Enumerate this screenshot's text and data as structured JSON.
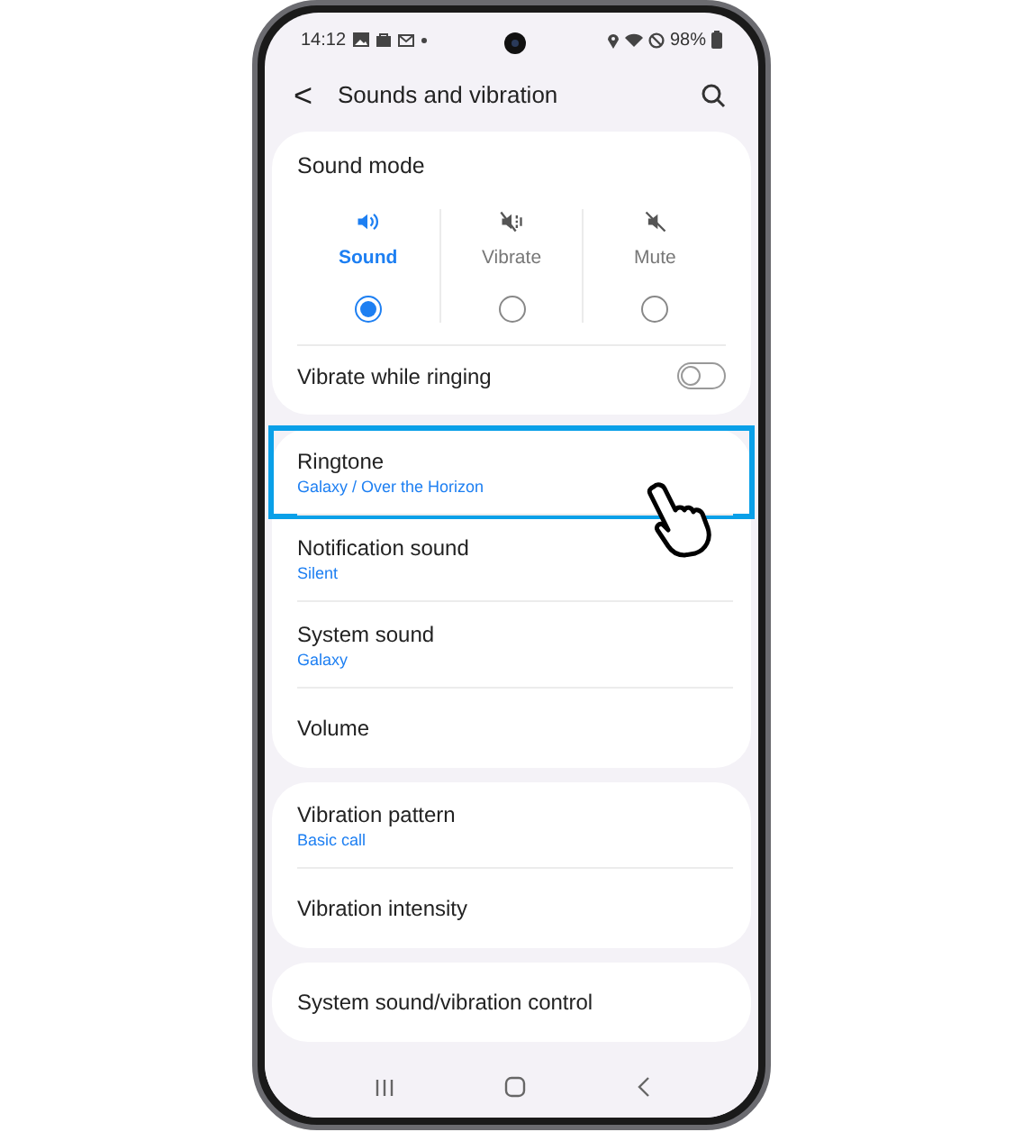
{
  "status_bar": {
    "time": "14:12",
    "battery": "98%"
  },
  "header": {
    "back": "<",
    "title": "Sounds and vibration"
  },
  "sound_mode": {
    "title": "Sound mode",
    "modes": [
      {
        "kind": "sound",
        "label": "Sound",
        "selected": true
      },
      {
        "kind": "vibrate",
        "label": "Vibrate",
        "selected": false
      },
      {
        "kind": "mute",
        "label": "Mute",
        "selected": false
      }
    ],
    "vibrate_while_ringing": {
      "label": "Vibrate while ringing",
      "on": false
    }
  },
  "groups": [
    {
      "items": [
        {
          "title": "Ringtone",
          "subtitle": "Galaxy / Over the Horizon",
          "highlighted": true
        },
        {
          "title": "Notification sound",
          "subtitle": "Silent",
          "highlighted": false
        },
        {
          "title": "System sound",
          "subtitle": "Galaxy",
          "highlighted": false
        },
        {
          "title": "Volume",
          "highlighted": false
        }
      ]
    },
    {
      "items": [
        {
          "title": "Vibration pattern",
          "subtitle": "Basic call",
          "highlighted": false
        },
        {
          "title": "Vibration intensity",
          "highlighted": false
        }
      ]
    },
    {
      "items": [
        {
          "title": "System sound/vibration control",
          "highlighted": false
        }
      ]
    }
  ]
}
